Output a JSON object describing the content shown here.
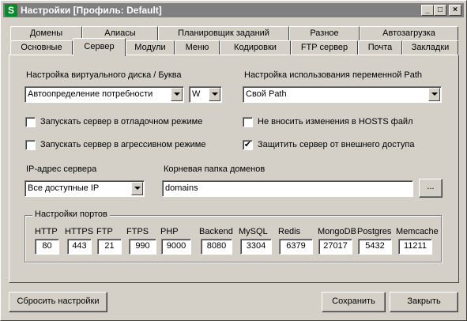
{
  "window": {
    "title": "Настройки [Профиль: Default]",
    "icon_letter": "S",
    "minimize_glyph": "_",
    "maximize_glyph": "□",
    "close_glyph": "×"
  },
  "tabs_back": [
    "Домены",
    "Алиасы",
    "Планировщик заданий",
    "Разное",
    "Автозагрузка"
  ],
  "tabs_front": [
    "Основные",
    "Сервер",
    "Модули",
    "Меню",
    "Кодировки",
    "FTP сервер",
    "Почта",
    "Закладки"
  ],
  "active_tab": "Сервер",
  "server": {
    "vdisk_label": "Настройка виртуального диска / Буква",
    "vdisk_value": "Автоопределение потребности",
    "drive_letter": "W",
    "path_label": "Настройка использования переменной Path",
    "path_value": "Свой Path",
    "checkboxes": [
      {
        "label": "Запускать сервер в отладочном режиме",
        "checked": false
      },
      {
        "label": "Запускать сервер в агрессивном режиме",
        "checked": false
      },
      {
        "label": "Не вносить изменения в HOSTS файл",
        "checked": false
      },
      {
        "label": "Защитить сервер от внешнего доступа",
        "checked": true
      }
    ],
    "check_mark": "✔",
    "ip_label": "IP-адрес сервера",
    "ip_value": "Все доступные IP",
    "root_label": "Корневая папка доменов",
    "root_value": "domains",
    "browse_label": "..."
  },
  "ports": {
    "group_label": "Настройки портов",
    "items": [
      {
        "name": "HTTP",
        "value": "80"
      },
      {
        "name": "HTTPS",
        "value": "443"
      },
      {
        "name": "FTP",
        "value": "21"
      },
      {
        "name": "FTPS",
        "value": "990"
      },
      {
        "name": "PHP",
        "value": "9000"
      },
      {
        "name": "Backend",
        "value": "8080"
      },
      {
        "name": "MySQL",
        "value": "3304"
      },
      {
        "name": "Redis",
        "value": "6379"
      },
      {
        "name": "MongoDB",
        "value": "27017"
      },
      {
        "name": "Postgres",
        "value": "5432"
      },
      {
        "name": "Memcache",
        "value": "11211"
      }
    ]
  },
  "buttons": {
    "reset": "Сбросить настройки",
    "save": "Сохранить",
    "close": "Закрыть"
  }
}
